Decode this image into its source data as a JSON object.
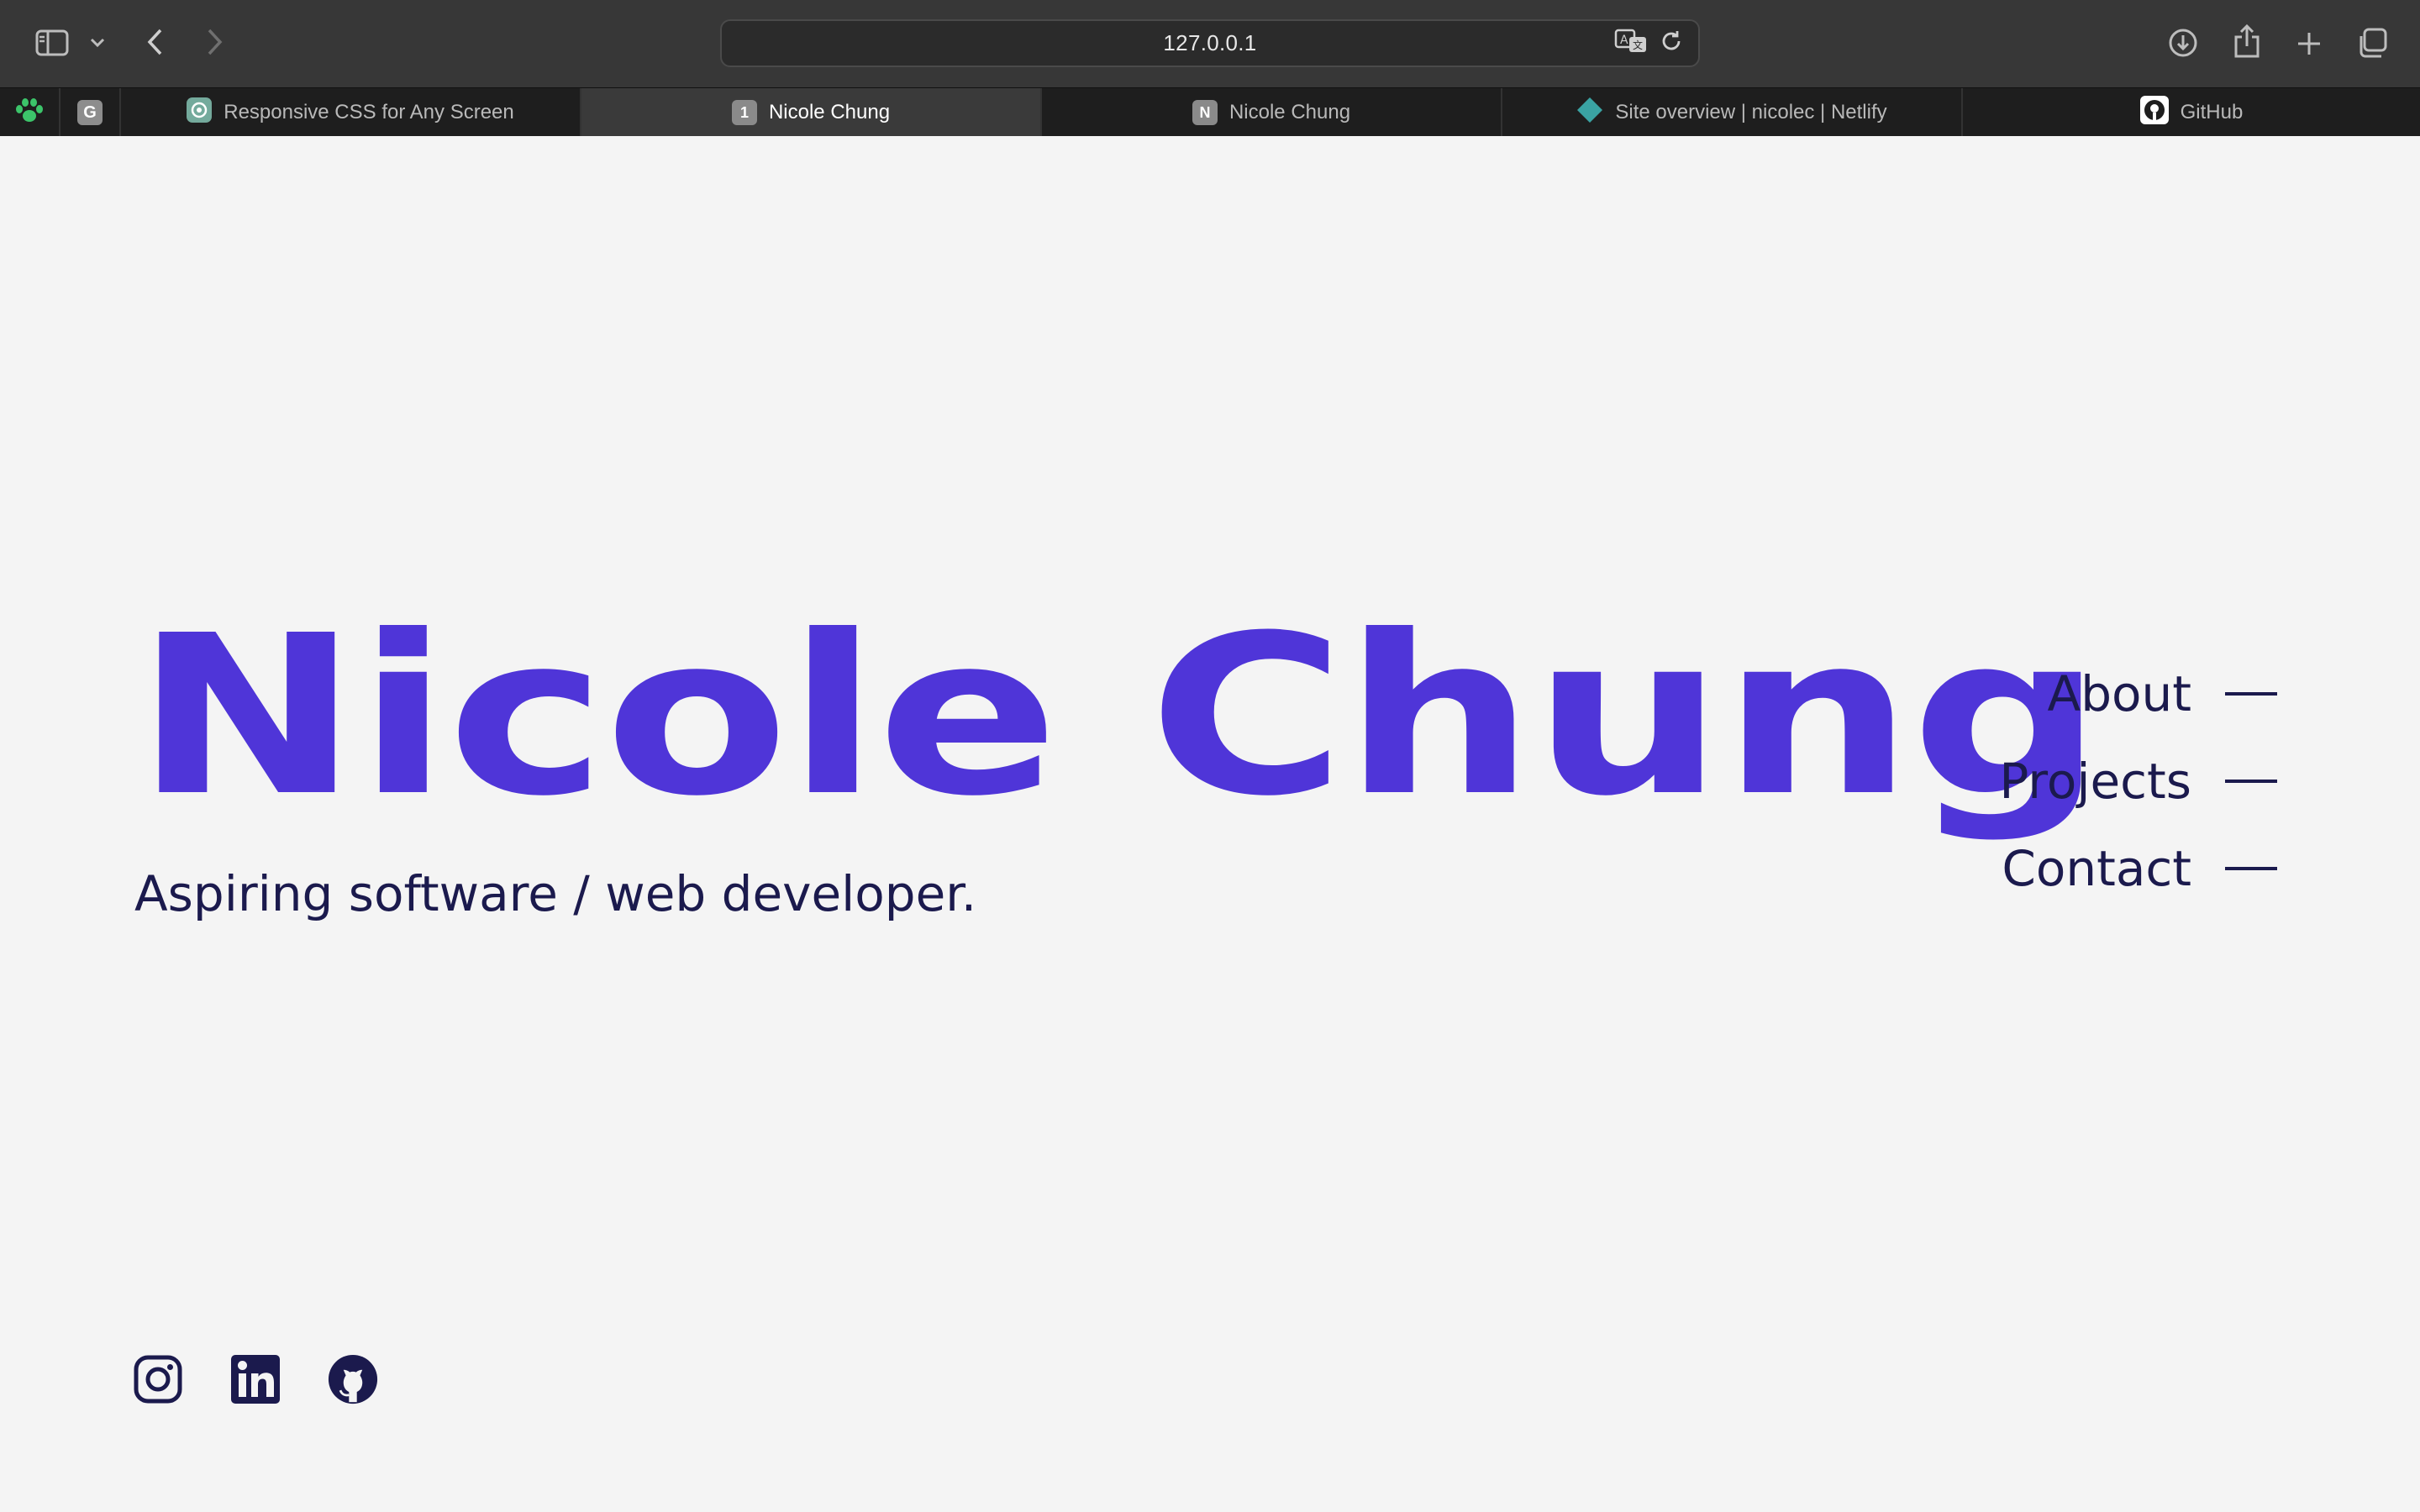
{
  "browser": {
    "url": "127.0.0.1",
    "icons": {
      "sidebar": "sidebar-icon",
      "dropdown": "chevron-down-icon",
      "back": "back-arrow-icon",
      "forward": "forward-arrow-icon",
      "translate": "translate-icon",
      "reload": "reload-icon",
      "downloads": "download-icon",
      "share": "share-icon",
      "new_tab": "plus-icon",
      "tab_overview": "tab-overview-icon"
    },
    "pinned_tabs": [
      {
        "icon": "paw-icon",
        "color": "#3cc46a"
      },
      {
        "letter": "G",
        "color": "#9a9a9a"
      }
    ],
    "tabs": [
      {
        "title": "Responsive CSS for Any Screen",
        "icon": "openai-icon",
        "active": false
      },
      {
        "title": "Nicole Chung",
        "fav_letter": "1",
        "active": true
      },
      {
        "title": "Nicole Chung",
        "fav_letter": "N",
        "active": false
      },
      {
        "title": "Site overview | nicolec | Netlify",
        "icon": "netlify-icon",
        "active": false
      },
      {
        "title": "GitHub",
        "icon": "github-icon",
        "active": false
      }
    ]
  },
  "page": {
    "name": "Nicole Chung",
    "tagline": "Aspiring software / web developer.",
    "nav": [
      {
        "label": "About"
      },
      {
        "label": "Projects"
      },
      {
        "label": "Contact"
      }
    ],
    "social": [
      "instagram-icon",
      "linkedin-icon",
      "github-icon"
    ],
    "colors": {
      "accent": "#4f35d8",
      "text": "#1b1a4d",
      "background": "#f4f4f4"
    }
  }
}
